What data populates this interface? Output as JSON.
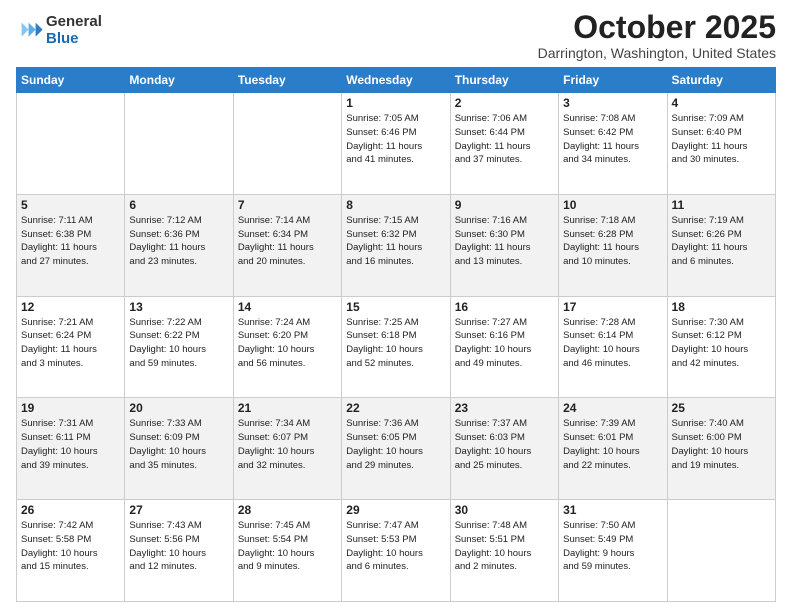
{
  "logo": {
    "general": "General",
    "blue": "Blue"
  },
  "header": {
    "month": "October 2025",
    "location": "Darrington, Washington, United States"
  },
  "weekdays": [
    "Sunday",
    "Monday",
    "Tuesday",
    "Wednesday",
    "Thursday",
    "Friday",
    "Saturday"
  ],
  "weeks": [
    [
      {
        "day": "",
        "info": ""
      },
      {
        "day": "",
        "info": ""
      },
      {
        "day": "",
        "info": ""
      },
      {
        "day": "1",
        "info": "Sunrise: 7:05 AM\nSunset: 6:46 PM\nDaylight: 11 hours\nand 41 minutes."
      },
      {
        "day": "2",
        "info": "Sunrise: 7:06 AM\nSunset: 6:44 PM\nDaylight: 11 hours\nand 37 minutes."
      },
      {
        "day": "3",
        "info": "Sunrise: 7:08 AM\nSunset: 6:42 PM\nDaylight: 11 hours\nand 34 minutes."
      },
      {
        "day": "4",
        "info": "Sunrise: 7:09 AM\nSunset: 6:40 PM\nDaylight: 11 hours\nand 30 minutes."
      }
    ],
    [
      {
        "day": "5",
        "info": "Sunrise: 7:11 AM\nSunset: 6:38 PM\nDaylight: 11 hours\nand 27 minutes."
      },
      {
        "day": "6",
        "info": "Sunrise: 7:12 AM\nSunset: 6:36 PM\nDaylight: 11 hours\nand 23 minutes."
      },
      {
        "day": "7",
        "info": "Sunrise: 7:14 AM\nSunset: 6:34 PM\nDaylight: 11 hours\nand 20 minutes."
      },
      {
        "day": "8",
        "info": "Sunrise: 7:15 AM\nSunset: 6:32 PM\nDaylight: 11 hours\nand 16 minutes."
      },
      {
        "day": "9",
        "info": "Sunrise: 7:16 AM\nSunset: 6:30 PM\nDaylight: 11 hours\nand 13 minutes."
      },
      {
        "day": "10",
        "info": "Sunrise: 7:18 AM\nSunset: 6:28 PM\nDaylight: 11 hours\nand 10 minutes."
      },
      {
        "day": "11",
        "info": "Sunrise: 7:19 AM\nSunset: 6:26 PM\nDaylight: 11 hours\nand 6 minutes."
      }
    ],
    [
      {
        "day": "12",
        "info": "Sunrise: 7:21 AM\nSunset: 6:24 PM\nDaylight: 11 hours\nand 3 minutes."
      },
      {
        "day": "13",
        "info": "Sunrise: 7:22 AM\nSunset: 6:22 PM\nDaylight: 10 hours\nand 59 minutes."
      },
      {
        "day": "14",
        "info": "Sunrise: 7:24 AM\nSunset: 6:20 PM\nDaylight: 10 hours\nand 56 minutes."
      },
      {
        "day": "15",
        "info": "Sunrise: 7:25 AM\nSunset: 6:18 PM\nDaylight: 10 hours\nand 52 minutes."
      },
      {
        "day": "16",
        "info": "Sunrise: 7:27 AM\nSunset: 6:16 PM\nDaylight: 10 hours\nand 49 minutes."
      },
      {
        "day": "17",
        "info": "Sunrise: 7:28 AM\nSunset: 6:14 PM\nDaylight: 10 hours\nand 46 minutes."
      },
      {
        "day": "18",
        "info": "Sunrise: 7:30 AM\nSunset: 6:12 PM\nDaylight: 10 hours\nand 42 minutes."
      }
    ],
    [
      {
        "day": "19",
        "info": "Sunrise: 7:31 AM\nSunset: 6:11 PM\nDaylight: 10 hours\nand 39 minutes."
      },
      {
        "day": "20",
        "info": "Sunrise: 7:33 AM\nSunset: 6:09 PM\nDaylight: 10 hours\nand 35 minutes."
      },
      {
        "day": "21",
        "info": "Sunrise: 7:34 AM\nSunset: 6:07 PM\nDaylight: 10 hours\nand 32 minutes."
      },
      {
        "day": "22",
        "info": "Sunrise: 7:36 AM\nSunset: 6:05 PM\nDaylight: 10 hours\nand 29 minutes."
      },
      {
        "day": "23",
        "info": "Sunrise: 7:37 AM\nSunset: 6:03 PM\nDaylight: 10 hours\nand 25 minutes."
      },
      {
        "day": "24",
        "info": "Sunrise: 7:39 AM\nSunset: 6:01 PM\nDaylight: 10 hours\nand 22 minutes."
      },
      {
        "day": "25",
        "info": "Sunrise: 7:40 AM\nSunset: 6:00 PM\nDaylight: 10 hours\nand 19 minutes."
      }
    ],
    [
      {
        "day": "26",
        "info": "Sunrise: 7:42 AM\nSunset: 5:58 PM\nDaylight: 10 hours\nand 15 minutes."
      },
      {
        "day": "27",
        "info": "Sunrise: 7:43 AM\nSunset: 5:56 PM\nDaylight: 10 hours\nand 12 minutes."
      },
      {
        "day": "28",
        "info": "Sunrise: 7:45 AM\nSunset: 5:54 PM\nDaylight: 10 hours\nand 9 minutes."
      },
      {
        "day": "29",
        "info": "Sunrise: 7:47 AM\nSunset: 5:53 PM\nDaylight: 10 hours\nand 6 minutes."
      },
      {
        "day": "30",
        "info": "Sunrise: 7:48 AM\nSunset: 5:51 PM\nDaylight: 10 hours\nand 2 minutes."
      },
      {
        "day": "31",
        "info": "Sunrise: 7:50 AM\nSunset: 5:49 PM\nDaylight: 9 hours\nand 59 minutes."
      },
      {
        "day": "",
        "info": ""
      }
    ]
  ]
}
